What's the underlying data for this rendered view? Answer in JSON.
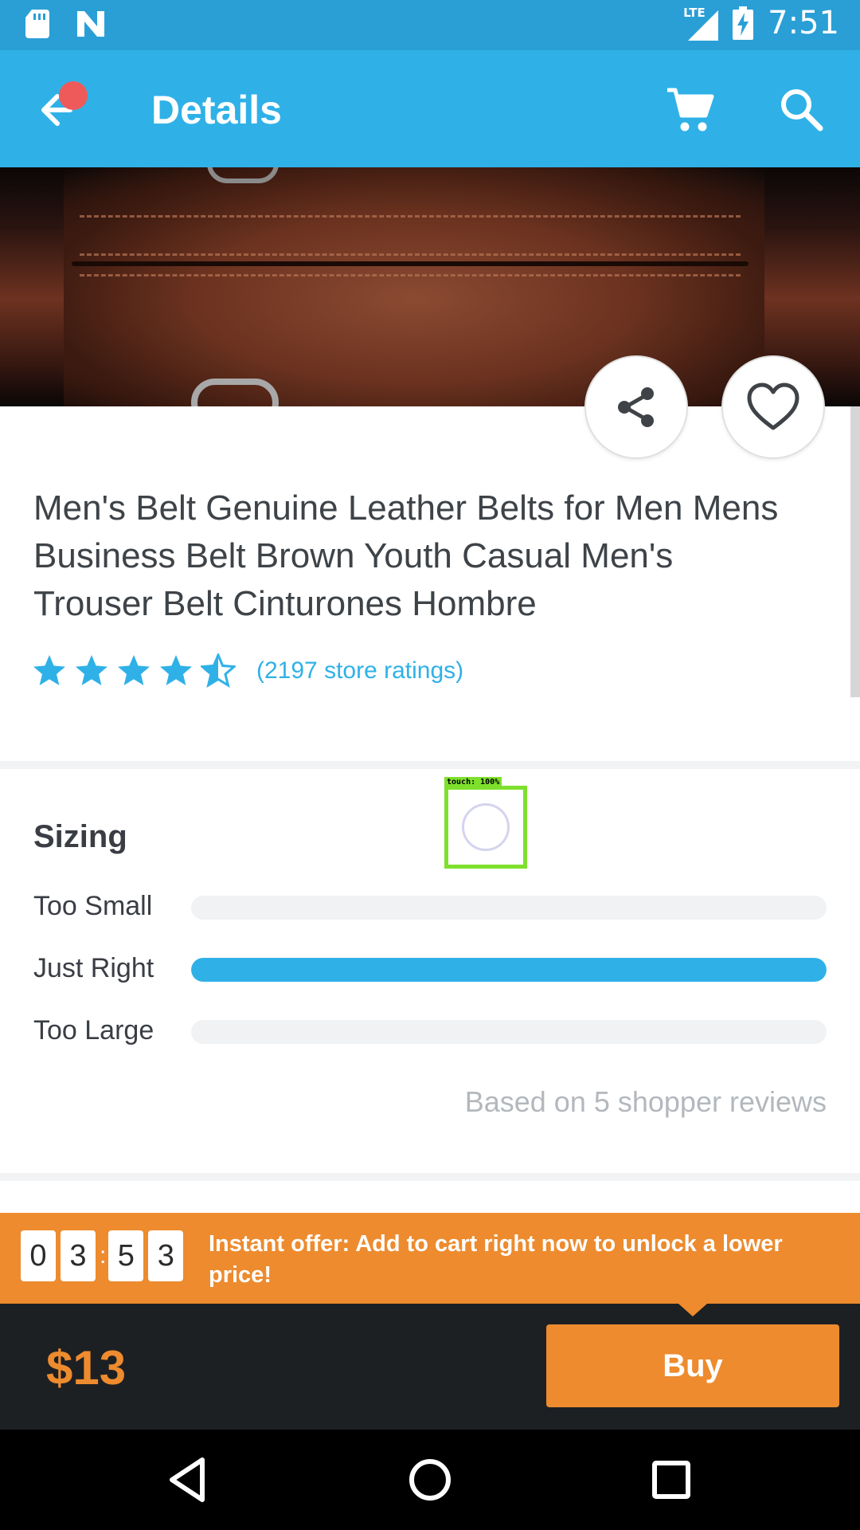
{
  "status_bar": {
    "time": "7:51",
    "network": "LTE",
    "icons": [
      "sd-card-icon",
      "n-notification-icon",
      "signal-icon",
      "battery-charging-icon"
    ]
  },
  "app_bar": {
    "title": "Details",
    "icons": [
      "back-arrow-icon",
      "cart-icon",
      "search-icon"
    ]
  },
  "product": {
    "title": "Men's Belt Genuine Leather Belts for Men Mens Business Belt Brown Youth Casual Men's Trouser Belt Cinturones Hombre",
    "rating_value": 4.5,
    "rating_max": 5,
    "rating_count_text": "(2197 store ratings)"
  },
  "sizing": {
    "title": "Sizing",
    "rows": [
      {
        "label": "Too Small",
        "fraction": 0
      },
      {
        "label": "Just Right",
        "fraction": 1
      },
      {
        "label": "Too Large",
        "fraction": 0
      }
    ],
    "based_on": "Based on 5 shopper reviews"
  },
  "touch_overlay": {
    "label": "touch: 100%"
  },
  "offer": {
    "timer_digits": [
      "0",
      "3",
      "5",
      "3"
    ],
    "separator": ":",
    "text": "Instant offer: Add to cart right now to unlock a lower price!"
  },
  "buy_bar": {
    "price": "$13",
    "buy_label": "Buy"
  },
  "colors": {
    "accent": "#2fb1e7",
    "status_bar": "#2a9fd6",
    "offer": "#ed8b2e",
    "buy_bar_bg": "#1d2023"
  }
}
